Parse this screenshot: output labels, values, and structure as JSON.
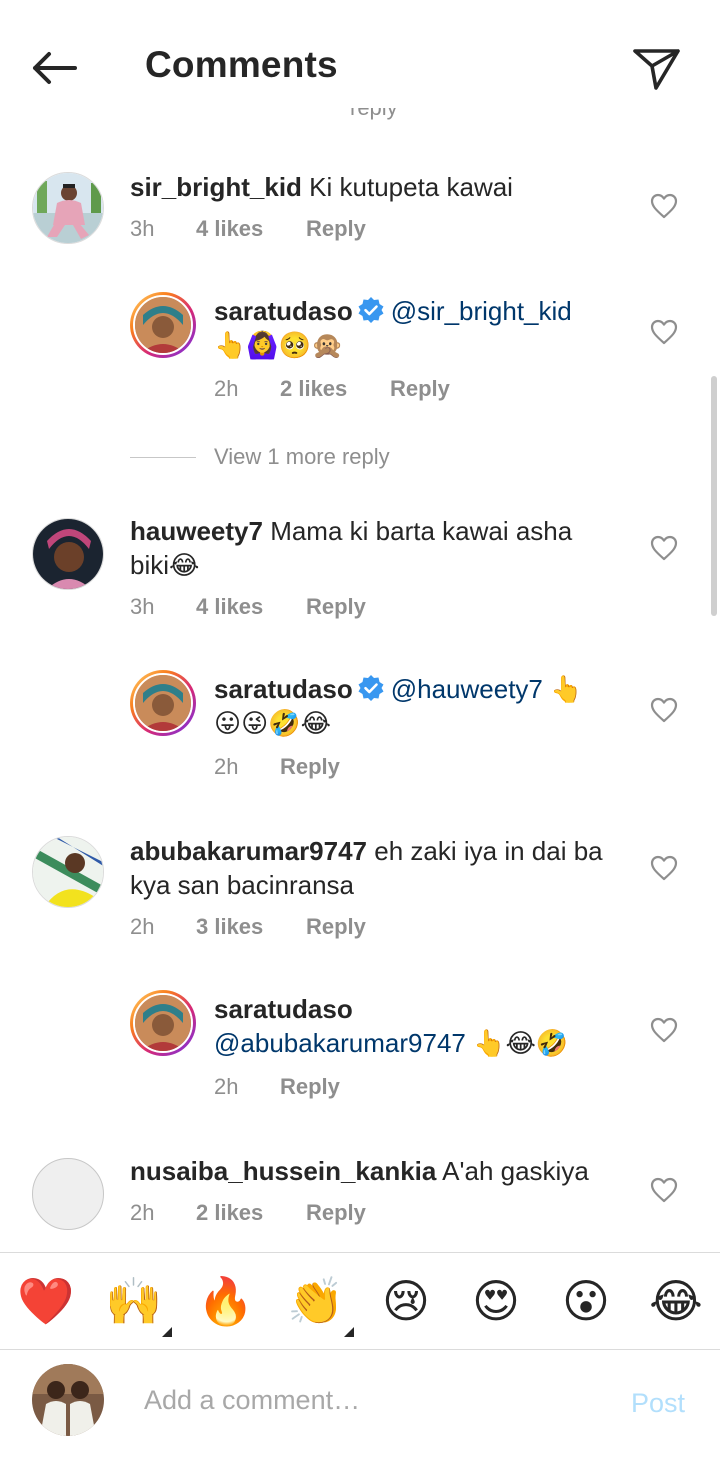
{
  "header": {
    "title": "Comments",
    "back_icon": "arrow-left-icon",
    "share_icon": "paper-plane-icon"
  },
  "comments": [
    {
      "username": "sir_bright_kid",
      "text": "Ki kutupeta kawai",
      "time": "3h",
      "likes": "4 likes",
      "reply": "Reply"
    },
    {
      "username": "saratudaso",
      "verified": true,
      "mention": "@sir_bright_kid",
      "emojis": "👆🙆‍♀️🥺🙊",
      "time": "2h",
      "likes": "2 likes",
      "reply": "Reply"
    },
    {
      "username": "hauweety7",
      "text": "Mama ki barta kawai asha biki😂",
      "time": "3h",
      "likes": "4 likes",
      "reply": "Reply"
    },
    {
      "username": "saratudaso",
      "verified": true,
      "mention": "@hauweety7",
      "tail": " 👆",
      "emojis": "😛😜🤣😂",
      "time": "2h",
      "reply": "Reply"
    },
    {
      "username": "abubakarumar9747",
      "text": "eh zaki iya in dai ba kya san bacinransa",
      "time": "2h",
      "likes": "3 likes",
      "reply": "Reply"
    },
    {
      "username": "saratudaso",
      "mention": "@abubakarumar9747",
      "emojis": " 👆😂🤣",
      "time": "2h",
      "reply": "Reply"
    },
    {
      "username": "nusaiba_hussein_kankia",
      "text": "A'ah gaskiya",
      "time": "2h",
      "likes": "2 likes",
      "reply": "Reply"
    }
  ],
  "view_more": "View 1 more reply",
  "emoji_bar": [
    "❤️",
    "🙌",
    "🔥",
    "👏",
    "😢",
    "😍",
    "😮",
    "😂"
  ],
  "composer": {
    "placeholder": "Add a comment…",
    "post_label": "Post"
  },
  "colors": {
    "text": "#262626",
    "secondary": "#8e8e8e",
    "mention": "#00376b",
    "verified": "#3897f0",
    "post_disabled": "#b2dffc"
  }
}
